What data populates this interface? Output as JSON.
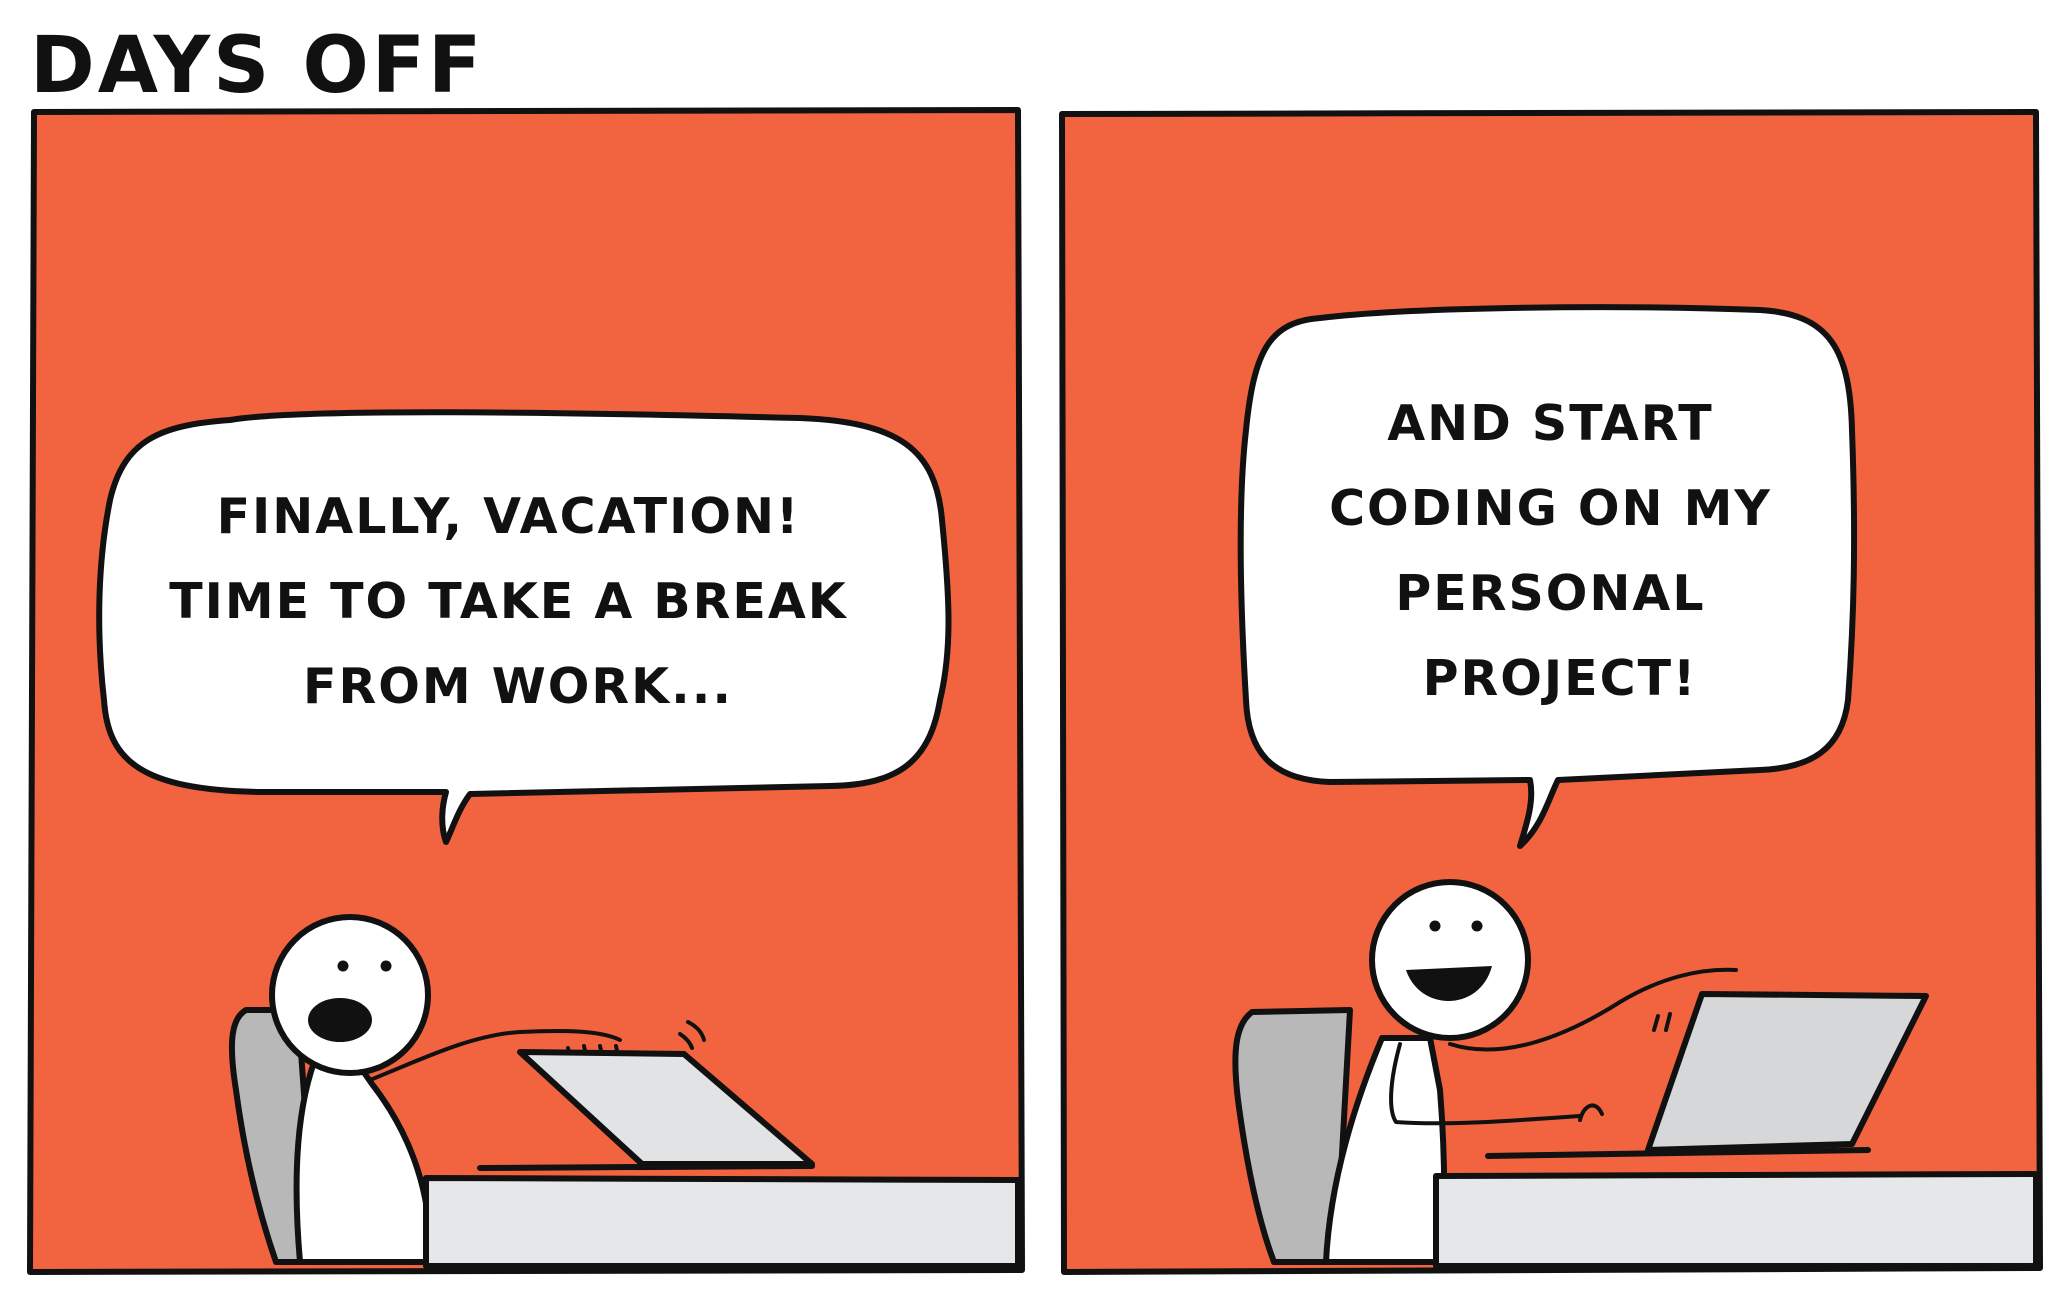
{
  "comic": {
    "title": "DAYS OFF",
    "colors": {
      "panel_background": "#f2643f",
      "ink": "#111111",
      "bubble_fill": "#ffffff",
      "chair": "#b8b8b8",
      "desk": "#e6e7e8",
      "laptop_lid": "#e2e3e5",
      "laptop_screen": "#d6d7d9"
    },
    "icons": [
      "stick-figure-icon",
      "office-chair-icon",
      "desk-icon",
      "laptop-icon",
      "speech-bubble-icon"
    ],
    "panels": [
      {
        "speech_lines": [
          "FINALLY, VACATION!",
          "TIME TO TAKE A BREAK",
          "FROM WORK..."
        ]
      },
      {
        "speech_lines": [
          "AND START",
          "CODING ON MY",
          "PERSONAL",
          "PROJECT!"
        ]
      }
    ]
  }
}
